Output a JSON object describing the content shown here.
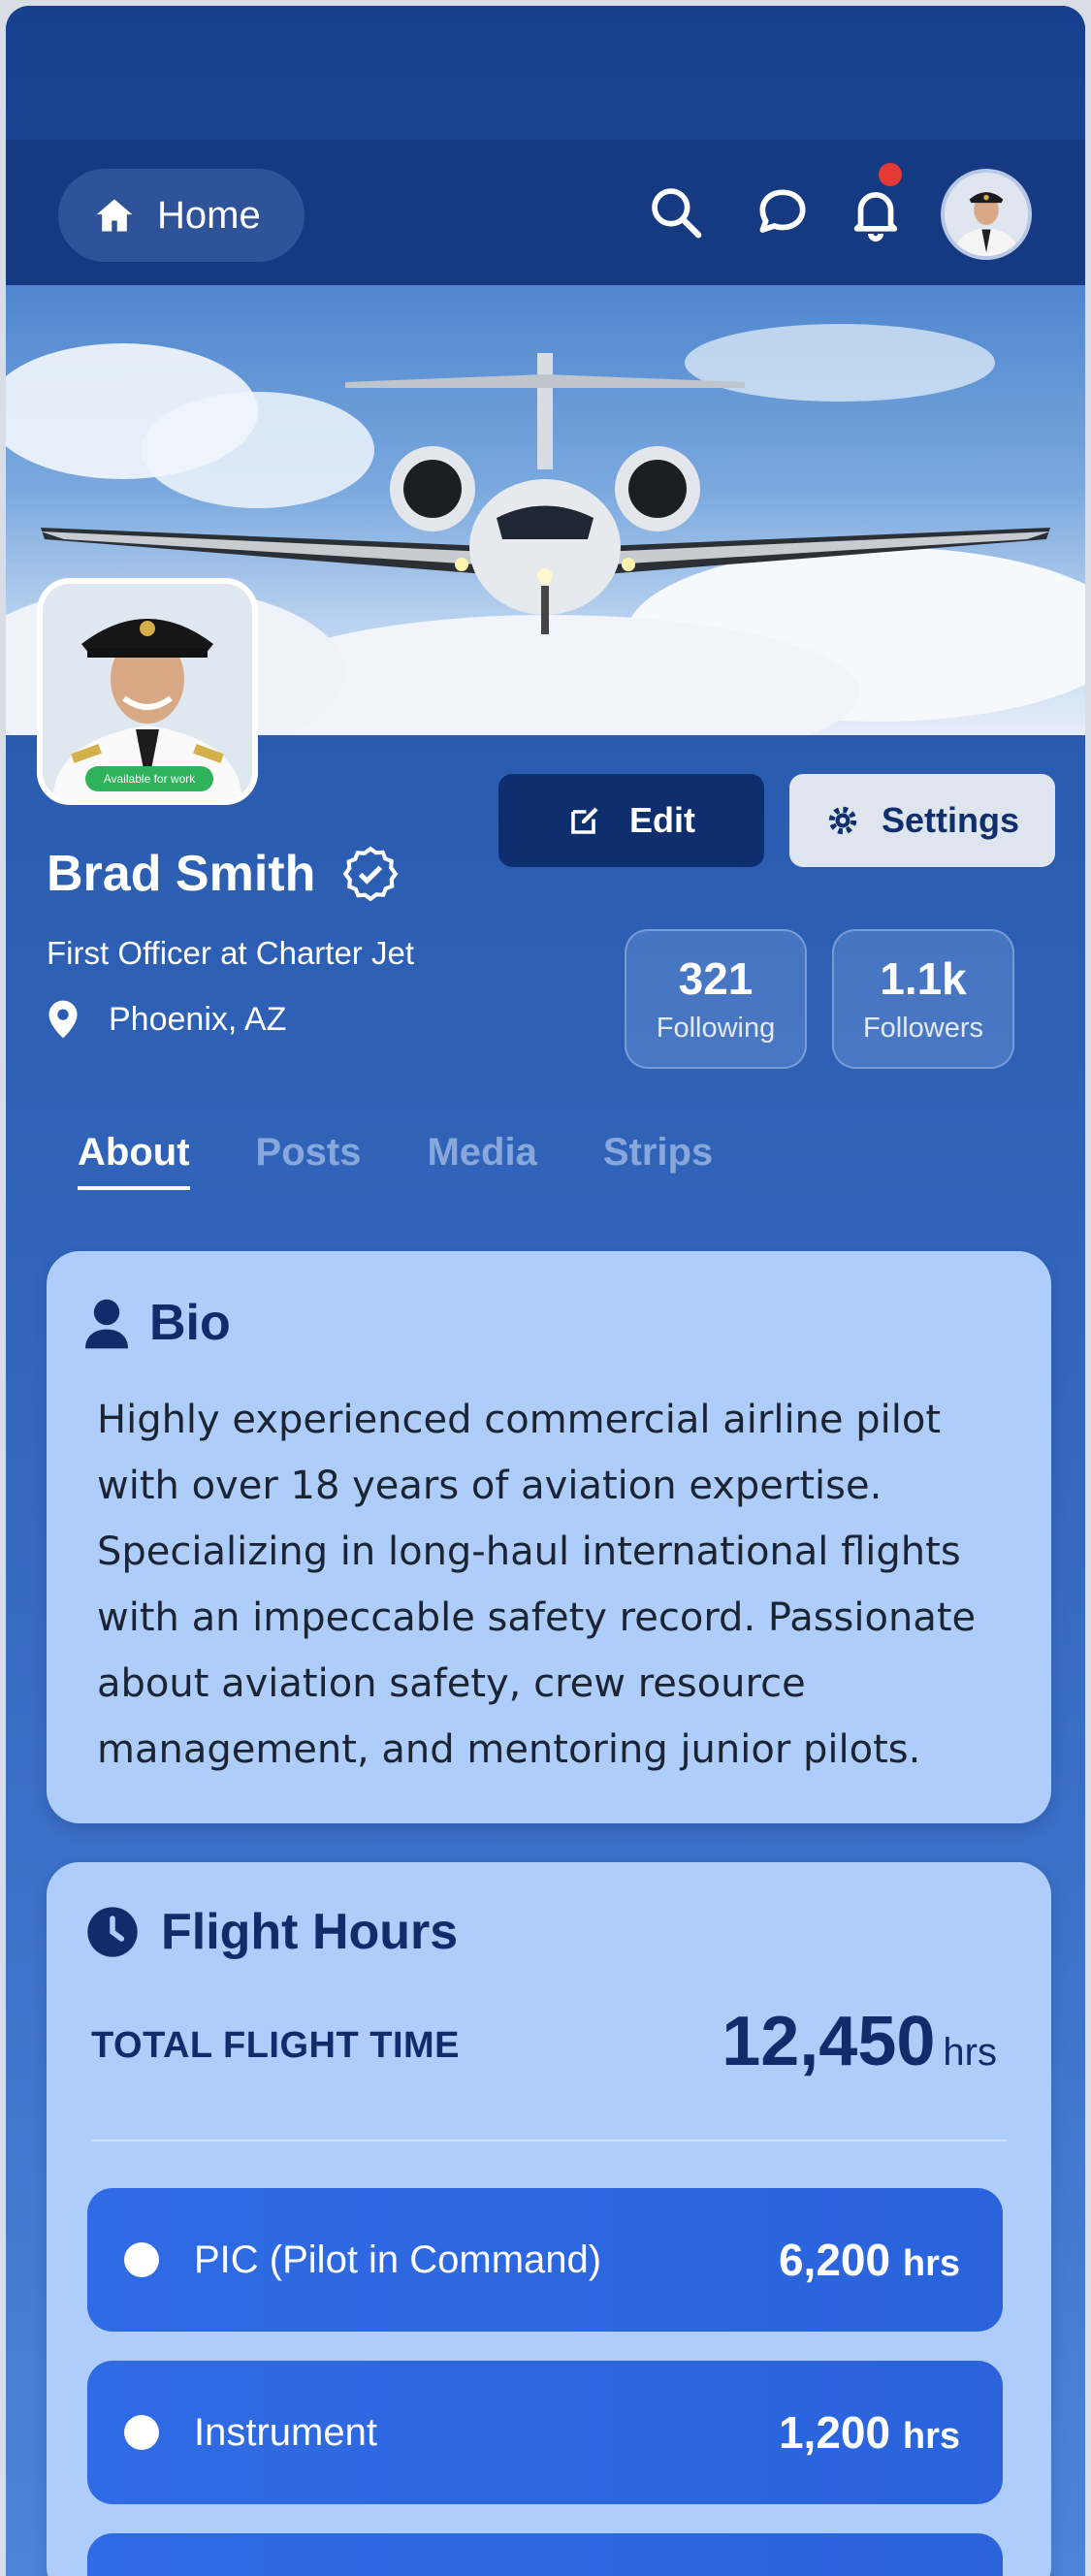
{
  "header": {
    "home_label": "Home",
    "icons": [
      "home-icon",
      "search-icon",
      "chat-icon",
      "bell-icon"
    ],
    "notification_dot_color": "#e53935"
  },
  "profile": {
    "name": "Brad Smith",
    "verified": true,
    "role": "First Officer at Charter Jet",
    "location": "Phoenix, AZ",
    "availability_badge": "Available for work",
    "edit_label": "Edit",
    "settings_label": "Settings",
    "stats": [
      {
        "value": "321",
        "label": "Following"
      },
      {
        "value": "1.1k",
        "label": "Followers"
      }
    ]
  },
  "tabs": [
    {
      "label": "About",
      "active": true
    },
    {
      "label": "Posts",
      "active": false
    },
    {
      "label": "Media",
      "active": false
    },
    {
      "label": "Strips",
      "active": false
    }
  ],
  "bio": {
    "title": "Bio",
    "text": "Highly experienced commercial airline pilot with over 18 years of aviation expertise. Specializing in long-haul international flights with an impeccable safety record. Passionate about aviation safety, crew resource management, and mentoring junior pilots."
  },
  "flight_hours": {
    "title": "Flight Hours",
    "total_label": "TOTAL FLIGHT TIME",
    "total_value": "12,450",
    "total_unit": "hrs",
    "rows": [
      {
        "label": "PIC (Pilot in Command)",
        "value": "6,200",
        "unit": "hrs"
      },
      {
        "label": "Instrument",
        "value": "1,200",
        "unit": "hrs"
      }
    ]
  },
  "colors": {
    "accent_dark": "#0f2e6e",
    "card_bg": "#aecdfb",
    "row_bg": "#2f6be4",
    "badge_green": "#2fb35a"
  }
}
